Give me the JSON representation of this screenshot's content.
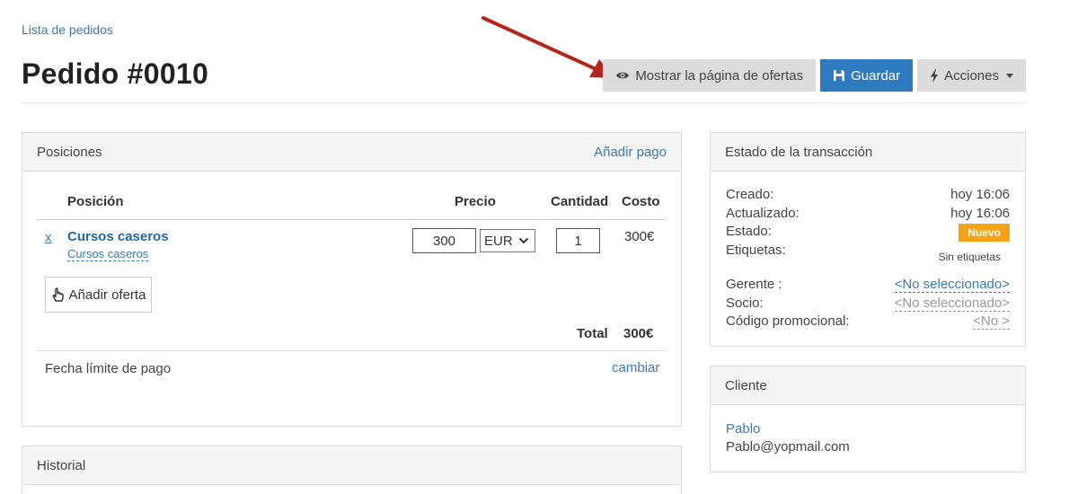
{
  "breadcrumb": {
    "label": "Lista de pedidos"
  },
  "page": {
    "title": "Pedido #0010"
  },
  "toolbar": {
    "show_offers_label": "Mostrar la página de ofertas",
    "save_label": "Guardar",
    "actions_label": "Acciones"
  },
  "positions": {
    "title": "Posiciones",
    "add_payment_label": "Añadir pago",
    "columns": {
      "position": "Posición",
      "price": "Precio",
      "quantity": "Cantidad",
      "cost": "Costo"
    },
    "items": [
      {
        "remove_label": "x",
        "name": "Cursos caseros",
        "sub": "Cursos caseros",
        "price": "300",
        "currency": "EUR",
        "quantity": "1",
        "cost": "300€"
      }
    ],
    "add_offer_label": "Añadir oferta",
    "total_label": "Total",
    "total_value": "300€",
    "deadline_label": "Fecha límite de pago",
    "change_label": "cambiar"
  },
  "history": {
    "title": "Historial"
  },
  "transaction": {
    "title": "Estado de la transacción",
    "created_label": "Creado:",
    "created_value": "hoy 16:06",
    "updated_label": "Actualizado:",
    "updated_value": "hoy 16:06",
    "status_label": "Estado:",
    "status_value": "Nuevo",
    "tags_label": "Etiquetas:",
    "tags_value": "Sin etiquetas",
    "manager_label": "Gerente :",
    "manager_value": "<No seleccionado>",
    "partner_label": "Socio:",
    "partner_value": "<No seleccionado>",
    "promo_label": "Código promocional:",
    "promo_value": "<No >"
  },
  "client": {
    "title": "Cliente",
    "name": "Pablo",
    "email": "Pablo@yopmail.com"
  },
  "colors": {
    "primary": "#2f7bbf",
    "link": "#3a7ab8",
    "badge": "#f5a312",
    "arrow": "#b5251b"
  },
  "icons": [
    "eye-icon",
    "save-icon",
    "bolt-icon",
    "caret-down-icon",
    "chevron-down-icon",
    "hand-pointer-icon",
    "arrow-annotation"
  ]
}
